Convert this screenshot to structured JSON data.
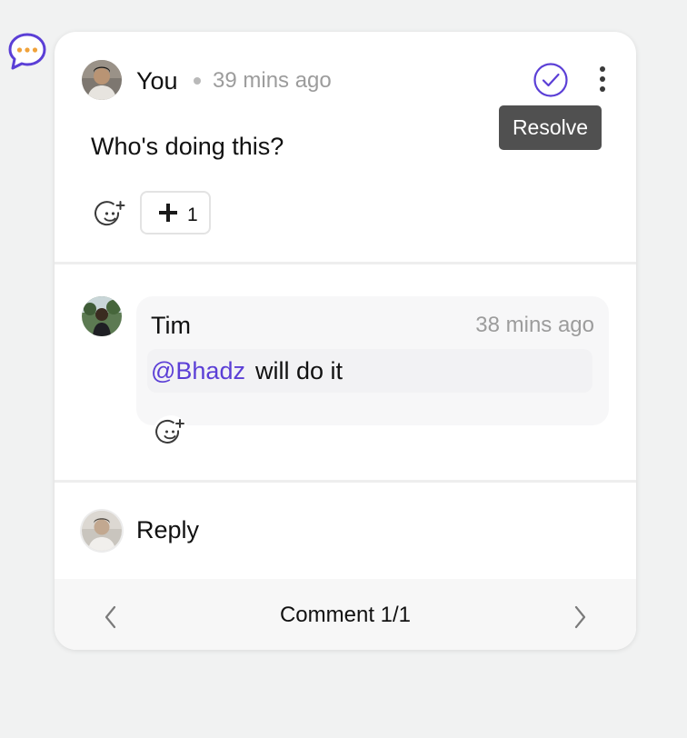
{
  "thread": {
    "author": "You",
    "time": "39 mins ago",
    "text": "Who's doing this?",
    "tooltip": "Resolve",
    "reaction_count": "1"
  },
  "reply": {
    "author": "Tim",
    "time": "38 mins ago",
    "mention": "@Bhadz",
    "text": "will do it"
  },
  "reply_input": {
    "label": "Reply"
  },
  "footer": {
    "label": "Comment 1/1"
  },
  "colors": {
    "accent": "#5b3fd6",
    "bubble_dots": "#f0a23a",
    "tooltip_bg": "#505050"
  }
}
